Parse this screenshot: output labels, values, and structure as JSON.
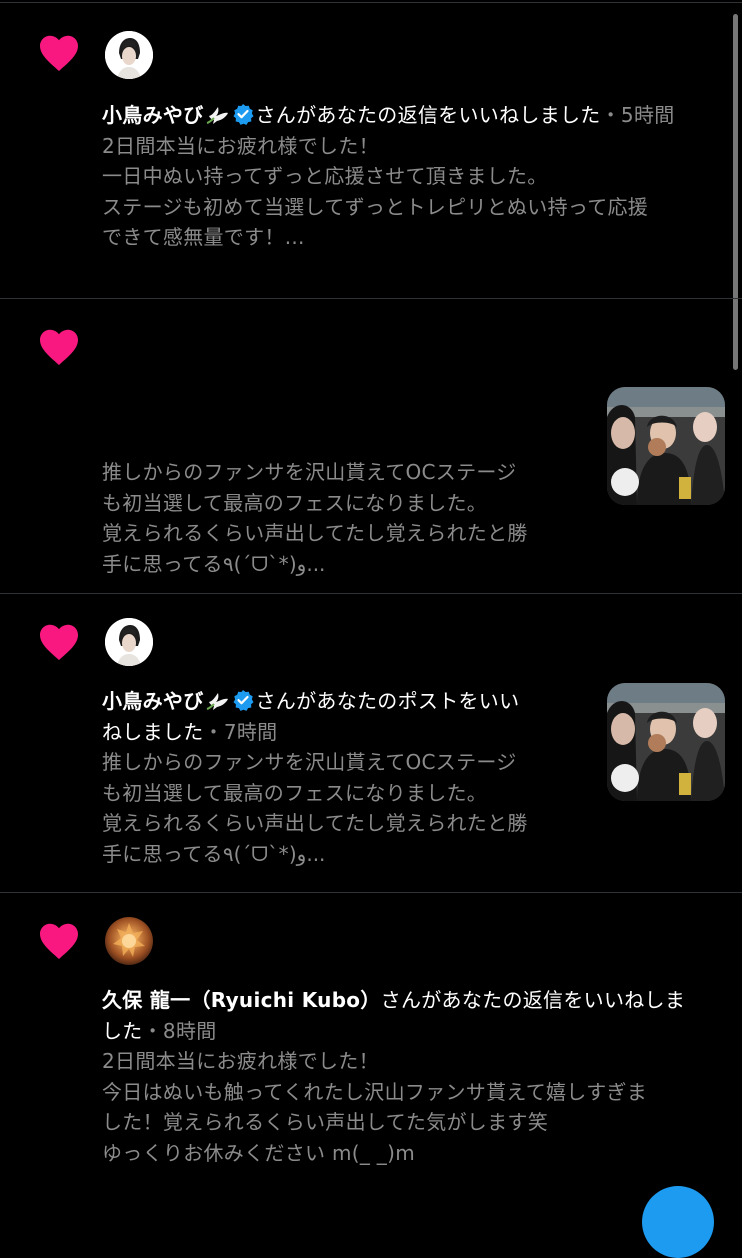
{
  "colors": {
    "heart": "#f91880",
    "verified": "#1d9bf0",
    "secondary_text": "#8b8b8b",
    "divider": "#2f3336"
  },
  "notifications": [
    {
      "icon": "heart-icon",
      "user_name": "小鳥みやび",
      "verified": true,
      "action": "さんがあなたの返信をいいねしました",
      "time_sep": "・",
      "time": "5時間",
      "body": [
        "2日間本当にお疲れ様でした！",
        "一日中ぬい持ってずっと応援させて頂きました。",
        "ステージも初めて当選してずっとトレピリとぬい持って応援",
        "できて感無量です！..."
      ]
    },
    {
      "icon": "heart-icon",
      "body": [
        "推しからのファンサを沢山貰えてOCステージ",
        "も初当選して最高のフェスになりました。",
        "覚えられるくらい声出してたし覚えられたと勝",
        "手に思ってる٩(ˊᗜˋ*)و..."
      ]
    },
    {
      "icon": "heart-icon",
      "user_name": "小鳥みやび",
      "verified": true,
      "action": "さんがあなたのポストをいい",
      "action_2": "ねしました",
      "time_sep": "・",
      "time": "7時間",
      "body": [
        "推しからのファンサを沢山貰えてOCステージ",
        "も初当選して最高のフェスになりました。",
        "覚えられるくらい声出してたし覚えられたと勝",
        "手に思ってる٩(ˊᗜˋ*)و..."
      ]
    },
    {
      "icon": "heart-icon",
      "user_name": "久保 龍一（Ryuichi Kubo）",
      "verified": false,
      "action": "さんがあなたの返信をいいねしま",
      "action_2": "した",
      "time_sep": "・",
      "time": "8時間",
      "body": [
        "2日間本当にお疲れ様でした！",
        "今日はぬいも触ってくれたし沢山ファンサ貰えて嬉しすぎま",
        "した！覚えられるくらい声出してた気がします笑",
        "ゆっくりお休みください m(_ _)m"
      ]
    }
  ]
}
